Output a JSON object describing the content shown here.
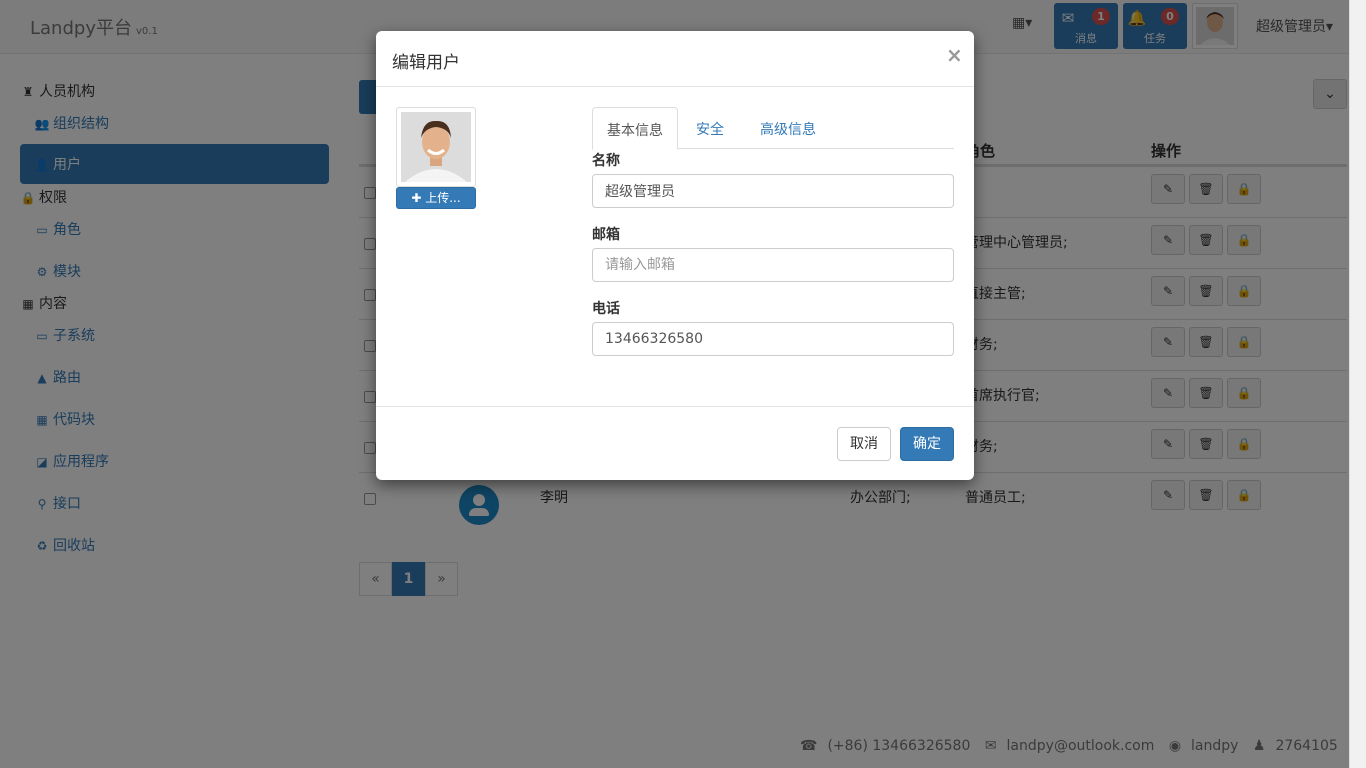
{
  "navbar": {
    "brand": "Landpy平台",
    "version": "v0.1",
    "apps_icon": "grid-icon",
    "messages": {
      "label": "消息",
      "badge": "1",
      "icon": "envelope-icon"
    },
    "tasks": {
      "label": "任务",
      "badge": "0",
      "icon": "bell-icon"
    },
    "user_name": "超级管理员",
    "caret": "▾"
  },
  "sidebar": {
    "groups": [
      {
        "label": "人员机构",
        "icon": "tower-icon"
      },
      {
        "label": "权限",
        "icon": "lock-icon"
      },
      {
        "label": "内容",
        "icon": "th-icon"
      }
    ],
    "items": [
      {
        "label": "组织结构",
        "icon": "users-icon"
      },
      {
        "label": "用户",
        "icon": "user-icon"
      },
      {
        "label": "角色",
        "icon": "credit-card-icon"
      },
      {
        "label": "模块",
        "icon": "cogs-icon"
      },
      {
        "label": "子系统",
        "icon": "desktop-icon"
      },
      {
        "label": "路由",
        "icon": "road-icon"
      },
      {
        "label": "代码块",
        "icon": "th-large-icon"
      },
      {
        "label": "应用程序",
        "icon": "cubes-icon"
      },
      {
        "label": "接口",
        "icon": "map-marker-icon"
      },
      {
        "label": "回收站",
        "icon": "recycle-icon"
      }
    ]
  },
  "table": {
    "headers": {
      "role": "角色",
      "actions": "操作"
    },
    "rows": [
      {
        "role": ""
      },
      {
        "role": "管理中心管理员;"
      },
      {
        "role": "直接主管;"
      },
      {
        "role": "财务;"
      },
      {
        "role": "首席执行官;"
      },
      {
        "role": "财务;"
      },
      {
        "name": "李明",
        "dept": "办公部门;",
        "role": "普通员工;"
      }
    ]
  },
  "pagination": {
    "prev": "«",
    "current": "1",
    "next": "»"
  },
  "footer": {
    "phone": "(+86) 13466326580",
    "email": "landpy@outlook.com",
    "github": "landpy",
    "qq": "2764105"
  },
  "modal": {
    "title": "编辑用户",
    "close": "×",
    "upload_label": "✚ 上传...",
    "tabs": [
      "基本信息",
      "安全",
      "高级信息"
    ],
    "fields": {
      "name": {
        "label": "名称",
        "value": "超级管理员"
      },
      "email": {
        "label": "邮箱",
        "value": "",
        "placeholder": "请输入邮箱"
      },
      "phone": {
        "label": "电话",
        "value": "13466326580"
      }
    },
    "cancel_label": "取消",
    "ok_label": "确定"
  },
  "colors": {
    "primary": "#337ab7",
    "badge": "#d9534f",
    "backdrop": "rgba(0,0,0,0.5)"
  }
}
